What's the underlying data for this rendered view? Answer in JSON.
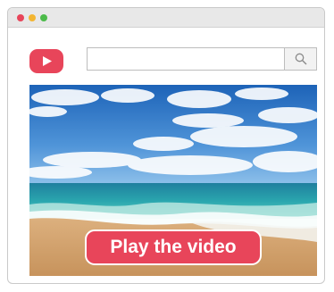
{
  "window": {
    "controls": [
      {
        "name": "close",
        "color": "#e8455a"
      },
      {
        "name": "minimize",
        "color": "#f3b531"
      },
      {
        "name": "maximize",
        "color": "#4cbb4a"
      }
    ]
  },
  "header": {
    "logo": {
      "icon": "video-play-logo-icon",
      "color": "#e8455a"
    },
    "search": {
      "value": "",
      "placeholder": "",
      "button_icon": "search-icon"
    }
  },
  "video": {
    "thumbnail": "beach-scene",
    "play_button_label": "Play the video",
    "play_button_color": "#e8455a"
  }
}
